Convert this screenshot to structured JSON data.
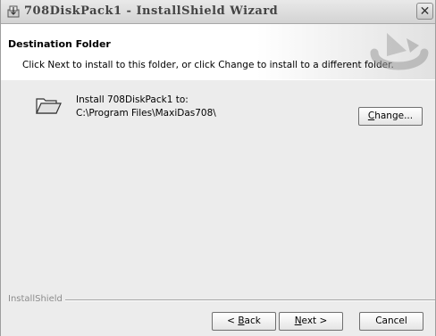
{
  "window": {
    "title": "708DiskPack1 - InstallShield Wizard",
    "close_glyph": "✕"
  },
  "banner": {
    "title": "Destination Folder",
    "subtitle": "Click Next to install to this folder, or click Change to install to a different folder."
  },
  "content": {
    "install_label": "Install 708DiskPack1 to:",
    "install_path": "C:\\Program Files\\MaxiDas708\\",
    "change_button": {
      "prefix": "",
      "accel": "C",
      "suffix": "hange..."
    }
  },
  "footer": {
    "brand": "InstallShield",
    "back_button": {
      "prefix": "< ",
      "accel": "B",
      "suffix": "ack"
    },
    "next_button": {
      "prefix": "",
      "accel": "N",
      "suffix": "ext >"
    },
    "cancel_button": {
      "label": "Cancel"
    }
  },
  "icons": {
    "app": "installer-icon",
    "folder": "folder-icon",
    "banner": "installshield-logo"
  },
  "colors": {
    "window_bg": "#ececec",
    "banner_bg": "#ffffff",
    "brand_text": "#8c8c8c"
  }
}
